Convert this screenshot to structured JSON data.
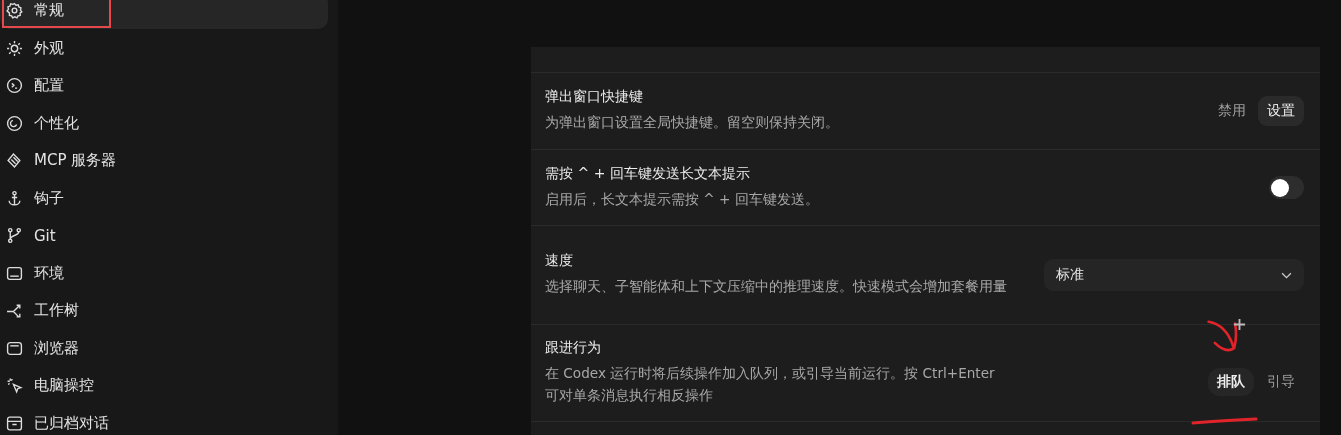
{
  "sidebar": {
    "items": [
      {
        "label": "常规",
        "selected": true
      },
      {
        "label": "外观",
        "selected": false
      },
      {
        "label": "配置",
        "selected": false
      },
      {
        "label": "个性化",
        "selected": false
      },
      {
        "label": "MCP 服务器",
        "selected": false
      },
      {
        "label": "钩子",
        "selected": false
      },
      {
        "label": "Git",
        "selected": false
      },
      {
        "label": "环境",
        "selected": false
      },
      {
        "label": "工作树",
        "selected": false
      },
      {
        "label": "浏览器",
        "selected": false
      },
      {
        "label": "电脑操控",
        "selected": false
      },
      {
        "label": "已归档对话",
        "selected": false
      }
    ]
  },
  "settings": {
    "rows": [
      {
        "kind": "shortcut",
        "title": "弹出窗口快捷键",
        "description": "为弹出窗口设置全局快捷键。留空则保持关闭。",
        "status": "禁用",
        "button": "设置"
      },
      {
        "kind": "toggle",
        "title": "需按 ^ + 回车键发送长文本提示",
        "description": "启用后，长文本提示需按 ^ + 回车键发送。",
        "on": false
      },
      {
        "kind": "select",
        "title": "速度",
        "description": "选择聊天、子智能体和上下文压缩中的推理速度。快速模式会增加套餐用量",
        "value": "标准"
      },
      {
        "kind": "segmented",
        "title": "跟进行为",
        "description": "在 Codex 运行时将后续操作加入队列，或引导当前运行。按 Ctrl+Enter 可对单条消息执行相反操作",
        "options": [
          {
            "label": "排队",
            "selected": true
          },
          {
            "label": "引导",
            "selected": false
          }
        ]
      }
    ]
  }
}
